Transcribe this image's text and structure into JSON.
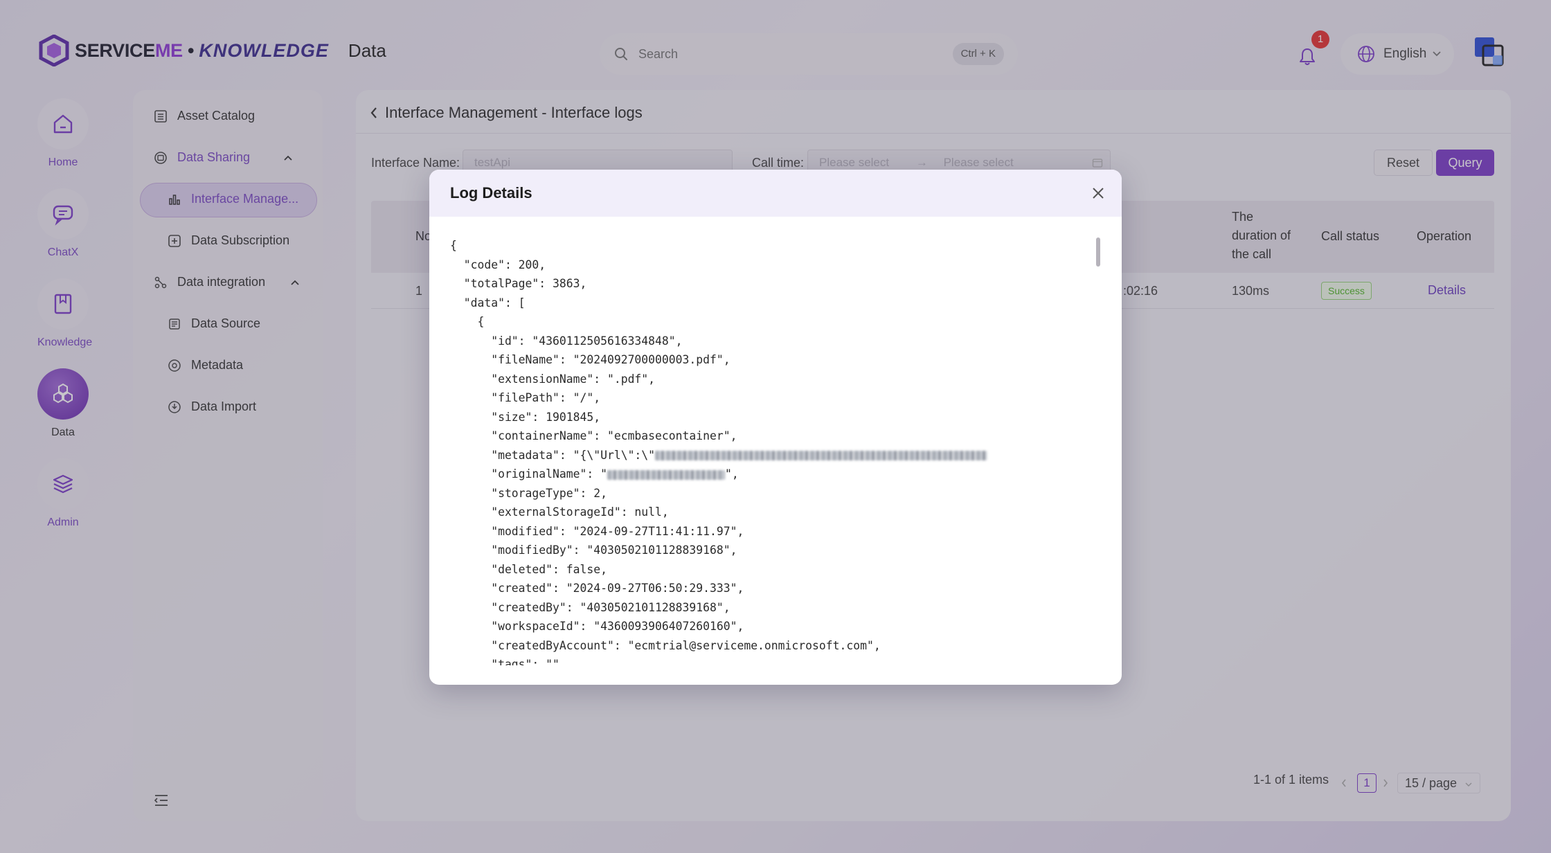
{
  "header": {
    "brand_service": "SERVICE",
    "brand_me": "ME",
    "brand_dot": " • ",
    "brand_knowledge": "KNOWLEDGE",
    "section": "Data",
    "search_placeholder": "Search",
    "search_shortcut": "Ctrl + K",
    "notification_count": "1",
    "language": "English"
  },
  "rail": [
    {
      "label": "Home",
      "icon": "home-icon"
    },
    {
      "label": "ChatX",
      "icon": "chat-icon"
    },
    {
      "label": "Knowledge",
      "icon": "book-icon"
    },
    {
      "label": "Data",
      "icon": "data-hexagon-icon"
    },
    {
      "label": "Admin",
      "icon": "layers-icon"
    }
  ],
  "sidebar": {
    "asset_catalog": "Asset Catalog",
    "data_sharing": "Data Sharing",
    "interface_management": "Interface Manage...",
    "data_subscription": "Data Subscription",
    "data_integration": "Data integration",
    "data_source": "Data Source",
    "metadata": "Metadata",
    "data_import": "Data Import"
  },
  "page": {
    "title": "Interface Management - Interface logs",
    "filters": {
      "interface_name_label": "Interface Name:",
      "interface_name_value": "testApi",
      "call_time_label": "Call time:",
      "start_placeholder": "Please select",
      "end_placeholder": "Please select",
      "arrow": "→"
    },
    "buttons": {
      "reset": "Reset",
      "query": "Query"
    },
    "table": {
      "headers": {
        "no": "No",
        "duration": [
          "The",
          "duration of",
          "the call"
        ],
        "status": "Call status",
        "operation": "Operation"
      },
      "rows": [
        {
          "no": "1",
          "time_tail": ":02:16",
          "duration": "130ms",
          "status": "Success",
          "operation": "Details"
        }
      ]
    },
    "pagination": {
      "summary": "1-1 of 1 items",
      "current": "1",
      "page_size": "15 / page"
    }
  },
  "modal": {
    "title": "Log Details",
    "json_lines": [
      "{",
      "  \"code\": 200,",
      "  \"totalPage\": 3863,",
      "  \"data\": [",
      "    {",
      "      \"id\": \"4360112505616334848\",",
      "      \"fileName\": \"2024092700000003.pdf\",",
      "      \"extensionName\": \".pdf\",",
      "      \"filePath\": \"/\",",
      "      \"size\": 1901845,",
      "      \"containerName\": \"ecmbasecontainer\",",
      "      \"metadata\": \"{\\\"Url\\\":\\\"",
      "      \"originalName\": \"",
      "      \"storageType\": 2,",
      "      \"externalStorageId\": null,",
      "      \"modified\": \"2024-09-27T11:41:11.97\",",
      "      \"modifiedBy\": \"4030502101128839168\",",
      "      \"deleted\": false,",
      "      \"created\": \"2024-09-27T06:50:29.333\",",
      "      \"createdBy\": \"4030502101128839168\",",
      "      \"workspaceId\": \"4360093906407260160\",",
      "      \"createdByAccount\": \"ecmtrial@serviceme.onmicrosoft.com\",",
      "      \"tags\": \"\""
    ],
    "original_name_tail": "\","
  },
  "colors": {
    "accent": "#7b3dc9",
    "success": "#52b52a",
    "badge": "#e63333"
  }
}
